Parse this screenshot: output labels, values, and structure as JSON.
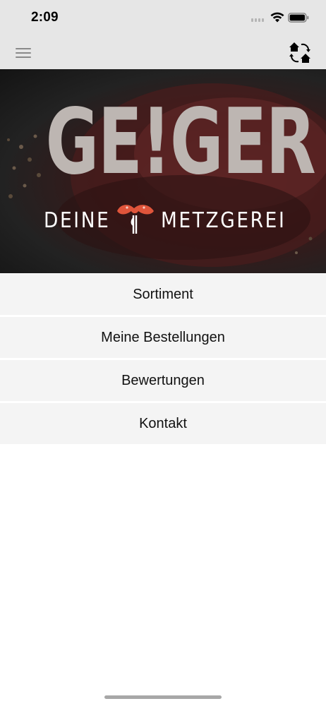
{
  "status_bar": {
    "time": "2:09"
  },
  "nav": {
    "menu_icon": "hamburger-menu-icon",
    "switch_icon": "switch-store-icon"
  },
  "hero": {
    "brand": "GE!GER",
    "tagline_left": "DEINE",
    "tagline_right": "METZGEREI",
    "accent_color": "#e0553b"
  },
  "menu": {
    "items": [
      {
        "label": "Sortiment"
      },
      {
        "label": "Meine Bestellungen"
      },
      {
        "label": "Bewertungen"
      },
      {
        "label": "Kontakt"
      }
    ]
  }
}
